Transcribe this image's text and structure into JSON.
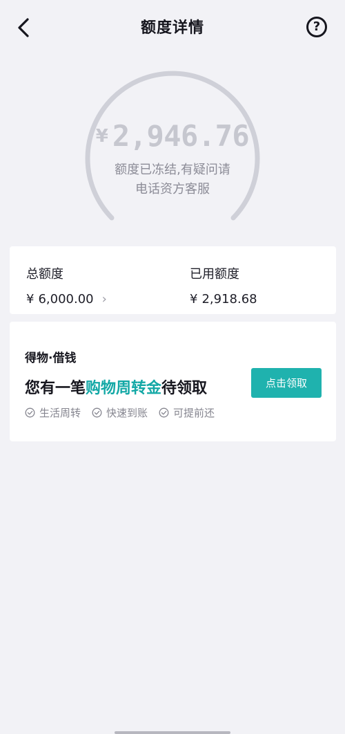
{
  "header": {
    "title": "额度详情",
    "help_symbol": "?"
  },
  "gauge": {
    "currency_symbol": "¥",
    "available_amount": "2,946.76",
    "status_line1": "额度已冻结,有疑问请",
    "status_line2": "电话资方客服"
  },
  "limits": {
    "total_label": "总额度",
    "total_currency": "¥",
    "total_value": "6,000.00",
    "total_chevron": "›",
    "used_label": "已用额度",
    "used_currency": "¥",
    "used_value": "2,918.68"
  },
  "loan": {
    "brand": "得物·借钱",
    "headline_prefix": "您有一笔",
    "headline_highlight": "购物周转金",
    "headline_suffix": "待领取",
    "claim_button": "点击领取",
    "features": [
      "生活周转",
      "快速到账",
      "可提前还"
    ]
  },
  "colors": {
    "background": "#f2f2f6",
    "accent": "#1fb2ae",
    "highlight_text": "#13a8a6",
    "gauge_arc": "#cfd0d8",
    "muted_amount": "#c6c7cf"
  },
  "icons": {
    "back": "chevron-left-icon",
    "help": "question-circle-icon",
    "feature": "check-circle-icon"
  }
}
